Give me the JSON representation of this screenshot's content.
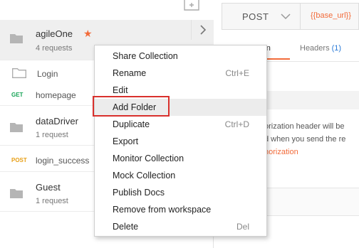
{
  "sidebar": {
    "collections": [
      {
        "name": "agileOne",
        "count": "4 requests",
        "starred": true
      },
      {
        "name": "dataDriver",
        "count": "1 request"
      },
      {
        "name": "Guest",
        "count": "1 request"
      }
    ],
    "folder": {
      "name": "Login"
    },
    "requests": [
      {
        "method": "GET",
        "name": "homepage"
      },
      {
        "method": "POST",
        "name": "login_success"
      }
    ]
  },
  "request_bar": {
    "method": "POST",
    "url": "{{base_url}}"
  },
  "tabs": {
    "authorization_partial": "ation",
    "headers_label": "Headers",
    "headers_count": "(1)"
  },
  "auth_panel": {
    "line1": "orization header will be",
    "line2": "d when you send the re",
    "link": "horization"
  },
  "context_menu": {
    "items": [
      {
        "label": "Share Collection",
        "shortcut": ""
      },
      {
        "label": "Rename",
        "shortcut": "Ctrl+E"
      },
      {
        "label": "Edit",
        "shortcut": ""
      },
      {
        "label": "Add Folder",
        "shortcut": ""
      },
      {
        "label": "Duplicate",
        "shortcut": "Ctrl+D"
      },
      {
        "label": "Export",
        "shortcut": ""
      },
      {
        "label": "Monitor Collection",
        "shortcut": ""
      },
      {
        "label": "Mock Collection",
        "shortcut": ""
      },
      {
        "label": "Publish Docs",
        "shortcut": ""
      },
      {
        "label": "Remove from workspace",
        "shortcut": ""
      },
      {
        "label": "Delete",
        "shortcut": "Del"
      }
    ],
    "hovered": "Add Folder"
  },
  "colors": {
    "accent": "#f26b3a",
    "get": "#15a355",
    "post": "#e8a017",
    "highlight": "#d9302c",
    "headers_count": "#2b7bd8"
  },
  "icons": {
    "folder": "folder-icon",
    "star": "star-icon",
    "chevron_right": "chevron-right-icon",
    "chevron_down": "chevron-down-icon",
    "new_collection": "new-collection-icon"
  }
}
